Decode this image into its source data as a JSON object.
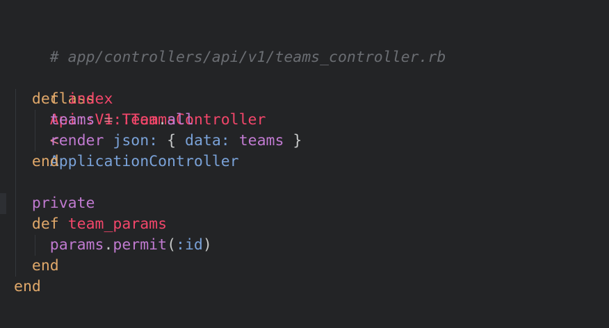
{
  "file_comment": "# app/controllers/api/v1/teams_controller.rb",
  "lines": {
    "l2": {
      "kw": "class",
      "name": "Api::V1::TeamsController",
      "op": "<",
      "parent": "ApplicationController"
    },
    "l3": {
      "kw": "def",
      "name": "index"
    },
    "l4": {
      "var": "teams",
      "op": "=",
      "const": "Team",
      "dot": ".",
      "call": "all"
    },
    "l5": {
      "call": "render",
      "key": "json:",
      "open": "{",
      "inner_key": "data:",
      "val": "teams",
      "close": "}"
    },
    "l6": {
      "kw": "end"
    },
    "l8": {
      "kw": "private"
    },
    "l9": {
      "kw": "def",
      "name": "team_params"
    },
    "l10": {
      "recv": "params",
      "dot": ".",
      "call": "permit",
      "open": "(",
      "sym": ":id",
      "close": ")"
    },
    "l11": {
      "kw": "end"
    },
    "l12": {
      "kw": "end"
    }
  },
  "colors": {
    "background": "#232426",
    "comment": "#6a6d72",
    "keyword": "#e0a86a",
    "class_name": "#f2466a",
    "parent_class": "#7aa2d8",
    "identifier": "#c07ad0",
    "symbol": "#7aa2d8"
  }
}
